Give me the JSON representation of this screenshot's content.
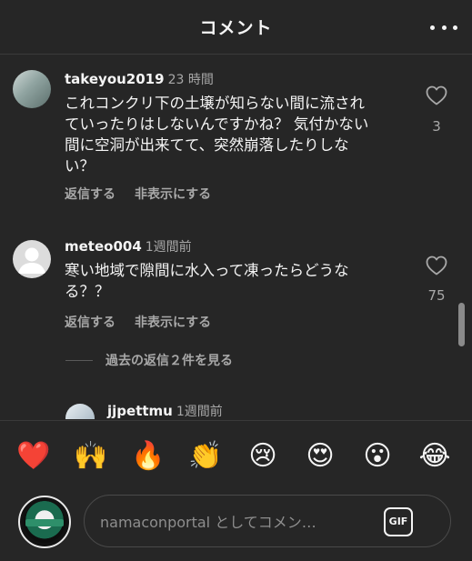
{
  "header": {
    "title": "コメント",
    "more_icon": "more-horizontal-icon"
  },
  "comments": [
    {
      "username": "takeyou2019",
      "time": "23 時間",
      "text_lines": [
        "これコンクリ下の土壌が知らない間に流され",
        "ていったりはしないんですかね？ 気付かない",
        "間に空洞が出来てて、突然崩落したりしな",
        "い？"
      ],
      "reply_label": "返信する",
      "hide_label": "非表示にする",
      "like_count": "3"
    },
    {
      "username": "meteo004",
      "time": "1週間前",
      "text_lines": [
        "寒い地域で隙間に水入って凍ったらどうな",
        "る？？"
      ],
      "reply_label": "返信する",
      "hide_label": "非表示にする",
      "like_count": "75"
    }
  ],
  "view_replies_label": "過去の返信２件を見る",
  "reply": {
    "username": "jjpettmu",
    "time": "1週間前"
  },
  "emojis": [
    {
      "char": "❤️",
      "name": "red-heart"
    },
    {
      "char": "🙌",
      "name": "raising-hands"
    },
    {
      "char": "🔥",
      "name": "fire"
    },
    {
      "char": "👏",
      "name": "clapping-hands"
    },
    {
      "char": "😢",
      "name": "crying-face"
    },
    {
      "char": "😍",
      "name": "heart-eyes"
    },
    {
      "char": "😮",
      "name": "surprised-face"
    },
    {
      "char": "😂",
      "name": "tears-of-joy"
    }
  ],
  "composer": {
    "placeholder": "namaconportal としてコメン…",
    "gif_label": "GIF"
  },
  "colors": {
    "background": "#262626",
    "text_primary": "#f5f5f5",
    "text_secondary": "#a8a8a8"
  }
}
